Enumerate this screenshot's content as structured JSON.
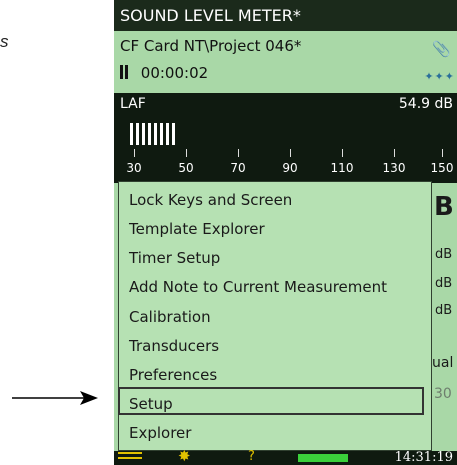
{
  "annotation": "s",
  "app": {
    "title": "SOUND LEVEL METER*",
    "project": "CF  Card NT\\Project 046*",
    "elapsed": "00:00:02"
  },
  "meter": {
    "parameter": "LAF",
    "value": "54.9 dB",
    "scale": [
      "30",
      "50",
      "70",
      "90",
      "110",
      "130",
      "150"
    ]
  },
  "menu": {
    "items": [
      "Lock Keys and Screen",
      "Template Explorer",
      "Timer Setup",
      "Add Note to Current Measurement",
      "Calibration",
      "Transducers",
      "Preferences",
      "Setup",
      "Explorer"
    ],
    "selected": "Setup"
  },
  "behind": {
    "big": "B",
    "unit1": "dB",
    "unit2": "dB",
    "unit3": "dB",
    "ual": "ual",
    "thirty": "30"
  },
  "statusbar": {
    "time": "14:31:19"
  },
  "colors": {
    "screen_bg": "#a9d8a7",
    "dark_bg": "#0f1a10",
    "accent_yellow": "#e2c200",
    "battery_green": "#3bd03b"
  }
}
